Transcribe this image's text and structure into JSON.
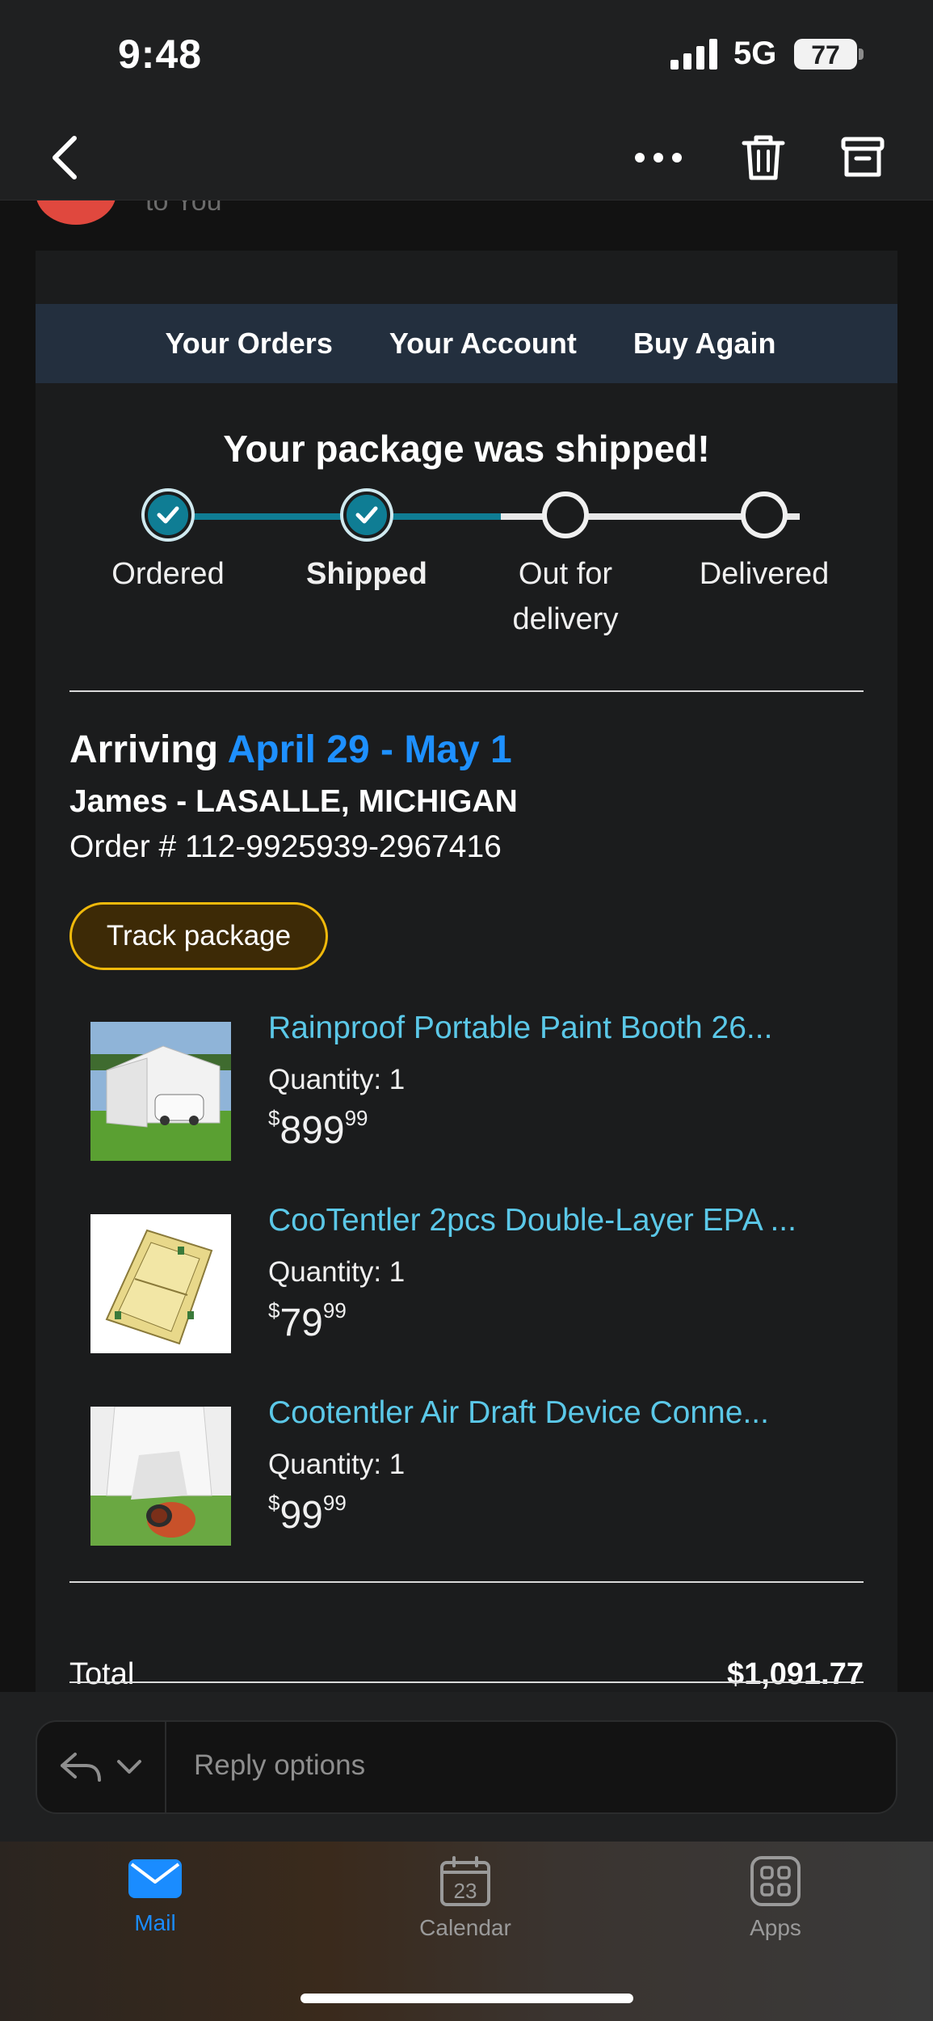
{
  "status_bar": {
    "time": "9:48",
    "network": "5G",
    "battery": "77"
  },
  "nav": {
    "back_icon": "chevron-left-icon",
    "more_icon": "ellipsis-icon",
    "trash_icon": "trash-icon",
    "archive_icon": "archive-icon"
  },
  "email": {
    "sender_peek": "to You"
  },
  "top_nav": {
    "orders": "Your Orders",
    "account": "Your Account",
    "buy_again": "Buy Again"
  },
  "shipment": {
    "title": "Your package was shipped!",
    "steps": [
      {
        "label": "Ordered",
        "state": "done"
      },
      {
        "label": "Shipped",
        "state": "done",
        "current": true
      },
      {
        "label": "Out for delivery",
        "state": "todo"
      },
      {
        "label": "Delivered",
        "state": "todo"
      }
    ],
    "arriving_label": "Arriving",
    "arriving_dates": "April 29 - May 1",
    "ship_to": "James - LASALLE, MICHIGAN",
    "order_number": "Order # 112-9925939-2967416",
    "track_button": "Track package"
  },
  "items": [
    {
      "title": "Rainproof Portable Paint Booth 26...",
      "quantity": "Quantity: 1",
      "price_dollars": "899",
      "price_cents": "99",
      "currency": "$"
    },
    {
      "title": "CooTentler 2pcs Double-Layer EPA ...",
      "quantity": "Quantity: 1",
      "price_dollars": "79",
      "price_cents": "99",
      "currency": "$"
    },
    {
      "title": "Cootentler Air Draft Device Conne...",
      "quantity": "Quantity: 1",
      "price_dollars": "99",
      "price_cents": "99",
      "currency": "$"
    }
  ],
  "total": {
    "label": "Total",
    "value": "$1,091.77"
  },
  "reply": {
    "placeholder": "Reply options"
  },
  "tabs": {
    "mail": "Mail",
    "calendar": "Calendar",
    "calendar_day": "23",
    "apps": "Apps"
  },
  "colors": {
    "accent_blue": "#1e90ff",
    "link_cyan": "#5bc8e8",
    "progress_teal": "#0f7d94",
    "track_button_border": "#f0b90b",
    "nav_bg": "#232f3e"
  }
}
